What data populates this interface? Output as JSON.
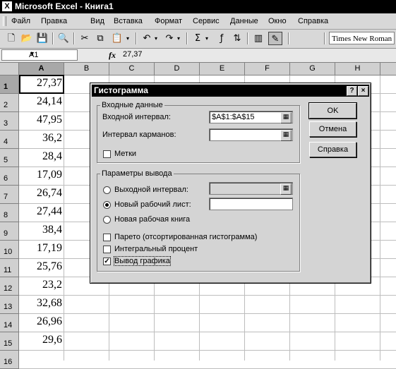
{
  "window": {
    "app_title": "Microsoft Excel - Книга1",
    "icon": "excel-icon"
  },
  "menu": [
    "Файл",
    "Правка",
    "Вид",
    "Вставка",
    "Формат",
    "Сервис",
    "Данные",
    "Окно",
    "Справка"
  ],
  "toolbar": {
    "font_name": "Times New Roman"
  },
  "formula_bar": {
    "name_box": "A1",
    "fx_label": "fx",
    "formula": "27,37"
  },
  "columns": [
    "A",
    "B",
    "C",
    "D",
    "E",
    "F",
    "G",
    "H"
  ],
  "rows": [
    "1",
    "2",
    "3",
    "4",
    "5",
    "6",
    "7",
    "8",
    "9",
    "10",
    "11",
    "12",
    "13",
    "14",
    "15",
    "16"
  ],
  "cells_a": [
    "27,37",
    "24,14",
    "47,95",
    "36,2",
    "28,4",
    "17,09",
    "26,74",
    "27,44",
    "38,4",
    "17,19",
    "25,76",
    "23,2",
    "32,68",
    "26,96",
    "29,6",
    ""
  ],
  "dialog": {
    "title": "Гистограмма",
    "help_btn": "?",
    "close_btn": "×",
    "input_group": "Входные данные",
    "input_range_label": "Входной интервал:",
    "input_range_value": "$A$1:$A$15",
    "bin_range_label": "Интервал карманов:",
    "bin_range_value": "",
    "labels_label": "Метки",
    "output_group": "Параметры вывода",
    "output_range_label": "Выходной интервал:",
    "new_sheet_label": "Новый рабочий лист:",
    "new_book_label": "Новая рабочая книга",
    "pareto_label": "Парето (отсортированная гистограмма)",
    "cumulative_label": "Интегральный процент",
    "chart_output_label": "Вывод графика",
    "ok": "OK",
    "cancel": "Отмена",
    "help": "Справка",
    "labels_checked": false,
    "pareto_checked": false,
    "cumulative_checked": false,
    "chart_output_checked": true,
    "selected_output": "new_sheet"
  }
}
